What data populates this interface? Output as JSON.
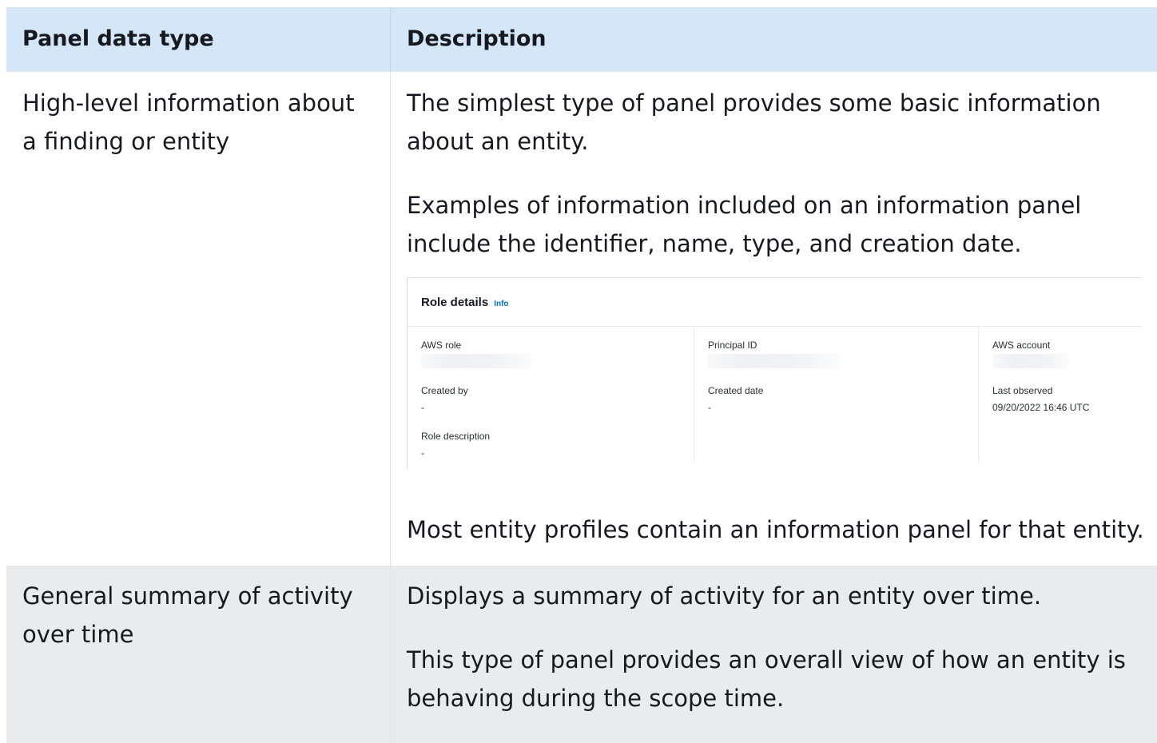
{
  "table": {
    "headers": [
      "Panel data type",
      "Description"
    ],
    "rows": [
      {
        "type": "High-level information about a finding or entity",
        "paragraphs": [
          "The simplest type of panel provides some basic information about an entity.",
          "Examples of information included on an information panel include the identifier, name, type, and creation date.",
          "Most entity profiles contain an information panel for that entity."
        ]
      },
      {
        "type": "General summary of activity over time",
        "paragraphs": [
          "Displays a summary of activity for an entity over time.",
          "This type of panel provides an overall view of how an entity is behaving during the scope time."
        ]
      }
    ]
  },
  "panel": {
    "title": "Role details",
    "info_link": "Info",
    "fields": {
      "aws_role": {
        "label": "AWS role",
        "value": ""
      },
      "principal_id": {
        "label": "Principal ID",
        "value": ""
      },
      "aws_account": {
        "label": "AWS account",
        "value": ""
      },
      "created_by": {
        "label": "Created by",
        "value": "-"
      },
      "created_date": {
        "label": "Created date",
        "value": "-"
      },
      "last_observed": {
        "label": "Last observed",
        "value": "09/20/2022 16:46 UTC"
      },
      "role_description": {
        "label": "Role description",
        "value": "-"
      }
    }
  }
}
